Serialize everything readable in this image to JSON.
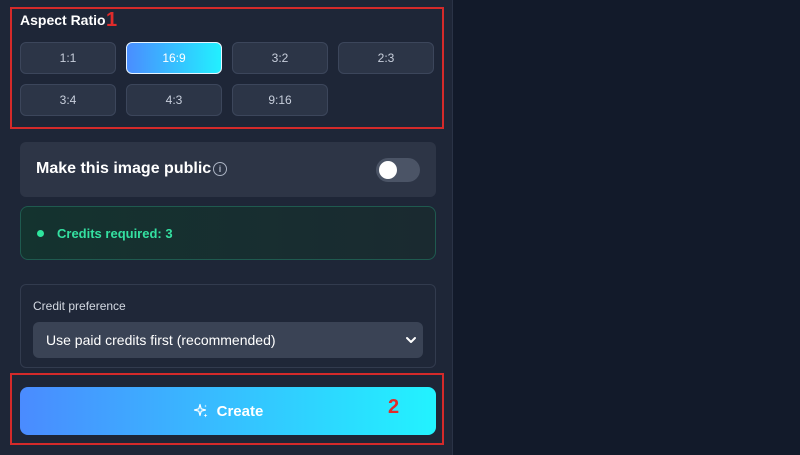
{
  "aspect_ratio": {
    "title": "Aspect Ratio",
    "options": [
      "1:1",
      "16:9",
      "3:2",
      "2:3",
      "3:4",
      "4:3",
      "9:16"
    ],
    "selected": "16:9"
  },
  "public": {
    "label": "Make this image public",
    "info_icon": "info-icon",
    "info_glyph": "i",
    "enabled": false
  },
  "credits": {
    "text": "Credits required: 3"
  },
  "preference": {
    "label": "Credit preference",
    "selected": "Use paid credits first (recommended)"
  },
  "create": {
    "label": "Create",
    "icon": "sparkle-icon"
  },
  "annotations": {
    "one": "1",
    "two": "2"
  },
  "colors": {
    "accent_start": "#4a8bff",
    "accent_end": "#22f3ff",
    "credits_green": "#34e0a1",
    "annotation_red": "#d42a2a"
  }
}
